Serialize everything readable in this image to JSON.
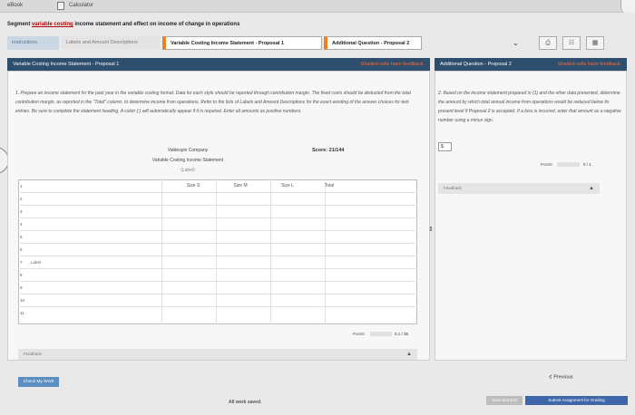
{
  "topbar": {
    "ebook": "eBook",
    "calculator": "Calculator"
  },
  "title": {
    "before": "Segment ",
    "keyword": "variable costing",
    "after": " income statement and effect on income of change in operations"
  },
  "tabs": [
    {
      "label": "Instructions"
    },
    {
      "label": "Labels and Amount Descriptions"
    },
    {
      "label": "Variable Costing Income Statement - Proposal 1"
    },
    {
      "label": "Additional Question - Proposal 2"
    }
  ],
  "left": {
    "header": "Variable Costing Income Statement - Proposal 1",
    "shaded_note": "Shaded cells have feedback.",
    "instructions": "1. Prepare an income statement for the past year in the variable costing format. Data for each style should be reported through contribution margin. The fixed costs should be deducted from the total contribution margin, as reported in the \"Total\" column, to determine income from operations. Refer to the lists of Labels and Amount Descriptions for the exact wording of the answer choices for text entries. Be sure to complete the statement heading. A colon (:) will automatically appear if it is required. Enter all amounts as positive numbers.",
    "company": "Valdespin Company",
    "statement": "Variable Costing Income Statement",
    "label_placeholder": "(Label)",
    "score": "Score: 21/144",
    "columns": [
      "Size S",
      "Size M",
      "Size L",
      "Total"
    ],
    "rows": [
      "1",
      "2",
      "3",
      "4",
      "5",
      "6",
      "7",
      "8",
      "9",
      "10",
      "11"
    ],
    "label_field": "Label",
    "points_label": "Points:",
    "points_value": "0.1 / 36",
    "points_fraction": 0.003,
    "feedback": "Feedback"
  },
  "right": {
    "header": "Additional Question - Proposal 2",
    "shaded_note": "Shaded cells have feedback.",
    "instructions": "2. Based on the income statement prepared in (1) and the other data presented, determine the amount by which total annual income from operations would be reduced below its present level if Proposal 2 is accepted. If a loss is incurred, enter that amount as a negative number using a minus sign.",
    "input_prefix": "$",
    "points_label": "Points:",
    "points_value": "0 / 1",
    "points_fraction": 0,
    "feedback": "Feedback"
  },
  "footer": {
    "check": "Check My Work",
    "previous": "Previous",
    "saved": "All work saved.",
    "save_exit": "Save and Exit",
    "submit": "Submit Assignment for Grading"
  },
  "colors": {
    "header": "#2d4e6d",
    "accent": "#f07f1f",
    "submit": "#3f66a8"
  }
}
